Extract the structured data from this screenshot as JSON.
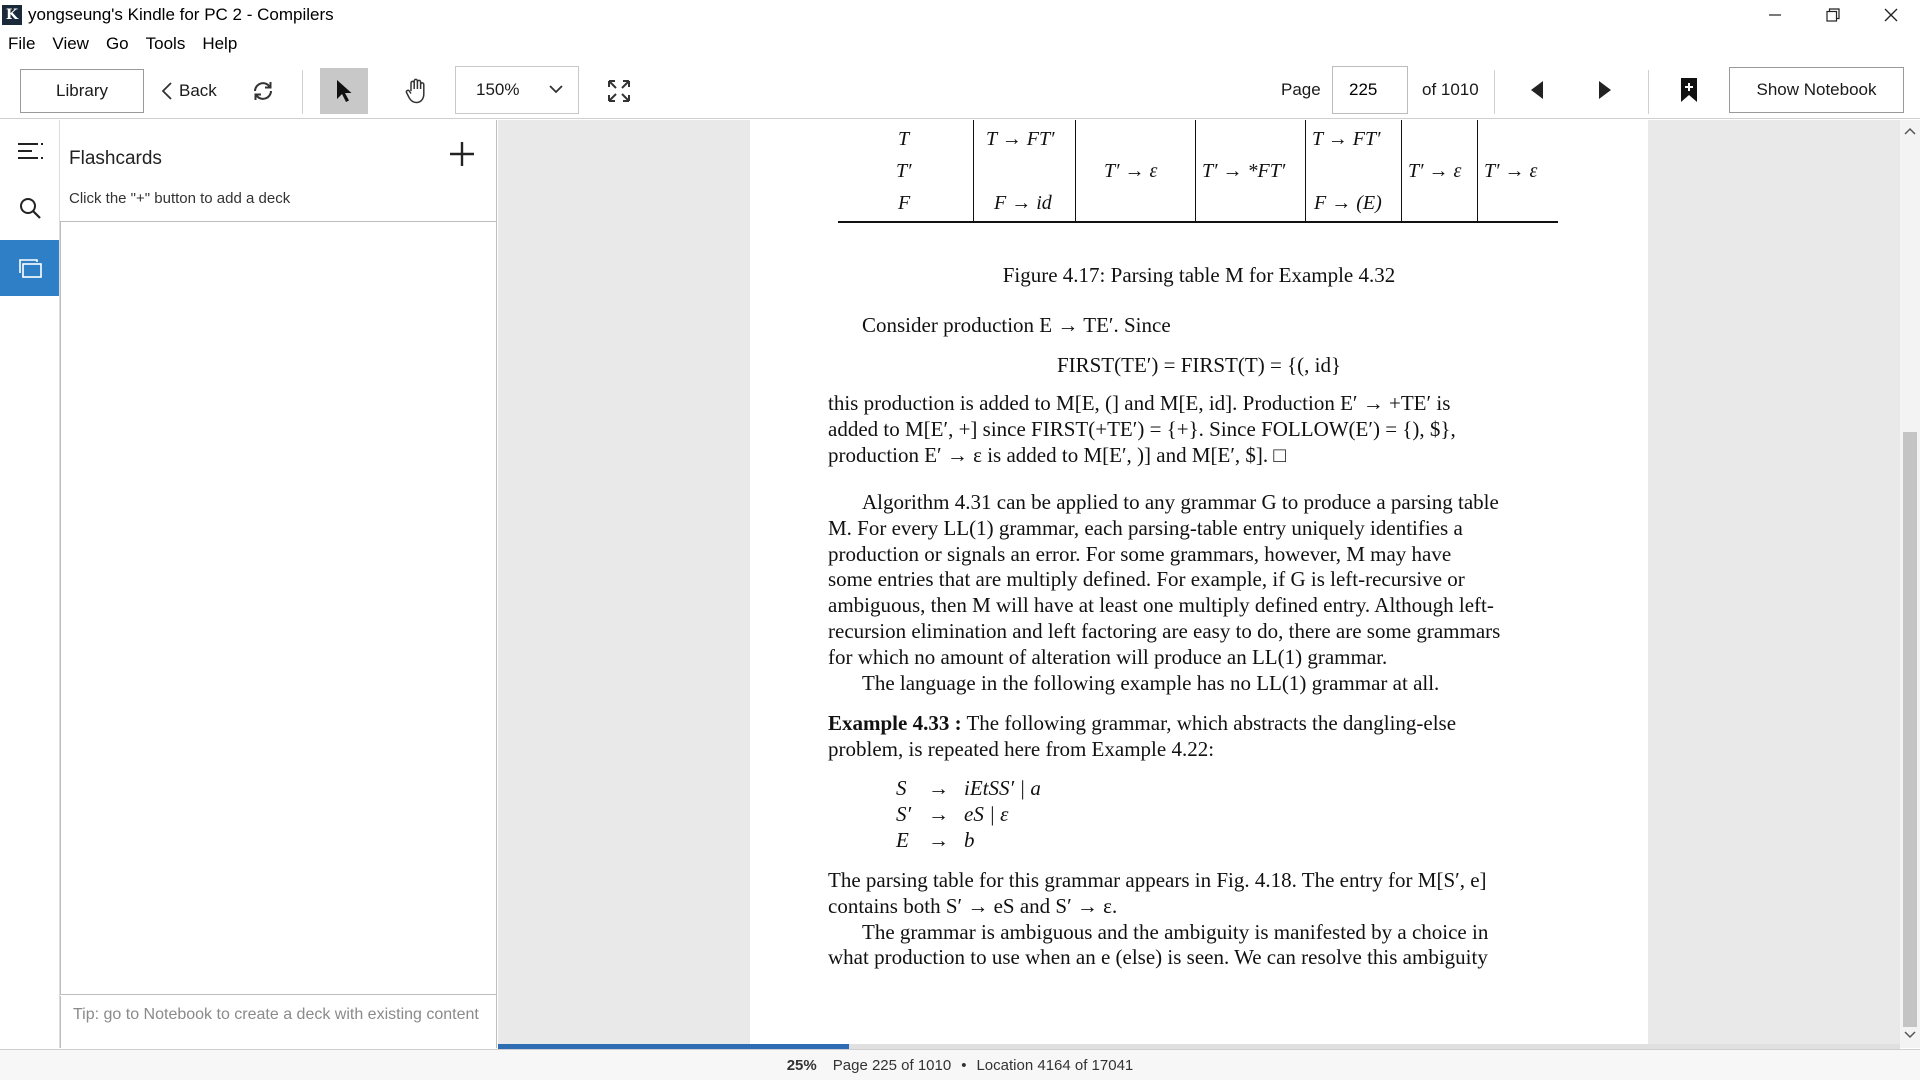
{
  "window": {
    "title": "yongseung's Kindle for PC 2 - Compilers",
    "logo_letter": "K"
  },
  "menu": [
    "File",
    "View",
    "Go",
    "Tools",
    "Help"
  ],
  "toolbar": {
    "library": "Library",
    "back": "Back",
    "zoom": "150%",
    "page_label": "Page",
    "page_value": "225",
    "page_of": "of 1010",
    "show_notebook": "Show Notebook"
  },
  "flashcards": {
    "title": "Flashcards",
    "hint": "Click the \"+\" button to add a deck",
    "tip": "Tip: go to Notebook to create a deck with existing content"
  },
  "book": {
    "table_rows": {
      "nonterminals": [
        "T",
        "T′",
        "F"
      ],
      "c1": [
        "T → FT′",
        "F → id"
      ],
      "c2": "T′ → ε",
      "c3": "T′ → *FT′",
      "c4": [
        "T → FT′",
        "F → (E)"
      ],
      "c5": "T′ → ε",
      "c6": "T′ → ε"
    },
    "figure_caption": "Figure 4.17: Parsing table M for Example 4.32",
    "consider": "Consider production E → TE′. Since",
    "first_eq": "FIRST(TE′)  =  FIRST(T)  =  {(, id}",
    "para1": [
      "this production is added to M[E, (] and M[E, id]. Production E′ → +TE′ is",
      "added to M[E′, +] since FIRST(+TE′) = {+}. Since FOLLOW(E′) = {), $},",
      "production E′ → ε is added to M[E′, )] and M[E′, $].    □"
    ],
    "para2": [
      "Algorithm 4.31 can be applied to any grammar G to produce a parsing table",
      "M. For every LL(1) grammar, each parsing-table entry uniquely identifies a",
      "production or signals an error. For some grammars, however, M may have",
      "some entries that are multiply defined. For example, if G is left-recursive or",
      "ambiguous, then M will have at least one multiply defined entry. Although left-",
      "recursion elimination and left factoring are easy to do, there are some grammars",
      "for which no amount of alteration will produce an LL(1) grammar."
    ],
    "para3": "The language in the following example has no LL(1) grammar at all.",
    "example_label": "Example 4.33 :",
    "example_text": [
      "The following grammar, which abstracts the dangling-else",
      "problem, is repeated here from Example 4.22:"
    ],
    "grammar": [
      [
        "S",
        "→",
        "iEtSS′ | a"
      ],
      [
        "S′",
        "→",
        "eS | ε"
      ],
      [
        "E",
        "→",
        "b"
      ]
    ],
    "para4": [
      "The parsing table for this grammar appears in Fig. 4.18. The entry for M[S′, e]",
      "contains both S′ → eS and S′ → ε."
    ],
    "para5": [
      "The grammar is ambiguous and the ambiguity is manifested by a choice in",
      "what production to use when an e (else) is seen. We can resolve this ambiguity"
    ]
  },
  "status": {
    "percent": "25%",
    "page": "Page 225 of 1010",
    "location": "Location 4164 of 17041",
    "progress_fraction": 0.25
  },
  "colors": {
    "accent": "#2e7fc6",
    "progress": "#2e6db4"
  }
}
